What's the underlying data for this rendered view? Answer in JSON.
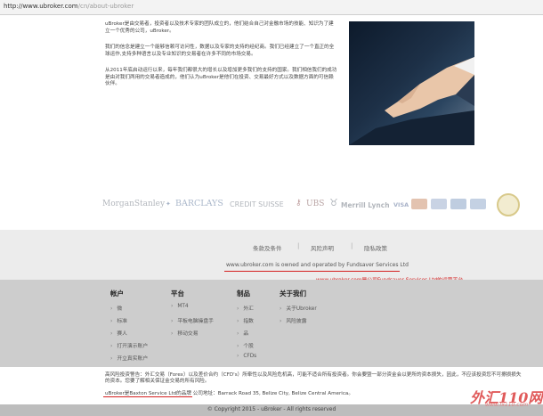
{
  "address_bar": {
    "url_main": "http://www.ubroker.com",
    "url_path": "/cn/about-ubroker"
  },
  "about": {
    "paragraphs": [
      "uBroker是由交易者，投资者以及技术专家的团队成立的，他们结合自己对金融市场的技能、知识为了建立一个优秀的公司，uBroker。",
      "我们的信念是建立一个能够信赖可访问性，数据以及专家的支持的经纪商。我们已经建立了一个直正的全球运作,支持多种语言以及专业知识的交易者在许多不同的市场交易。",
      "从2011年底启动运行以来，每年我们都很大的增长以及增加更多我们的支持的国家。我们相信我们的成功是由对我们两用的交易者造成的，他们认为uBroker是他们在投资、交易最好方式以及数据方面的可信赖伙伴。"
    ]
  },
  "partners": [
    "MorganStanley",
    "BARCLAYS",
    "CREDIT SUISSE",
    "UBS",
    "Merrill Lynch",
    "VISA"
  ],
  "footer_links": [
    "条款及条件",
    "风险声明",
    "隐私政策"
  ],
  "owned_text": "www.ubroker.com is owned and operated by Fundsaver Services Ltd",
  "owned_note": "www.ubroker.com是公司Fundsaver Services Ltd的运营平台",
  "menu": {
    "accounts": {
      "title": "帐户",
      "items": [
        "微",
        "标准",
        "赛人",
        "打开演示账户",
        "开立真实账户"
      ]
    },
    "platform": {
      "title": "平台",
      "items": [
        "MT4",
        "平板电脑操盘手",
        "移动交易"
      ]
    },
    "products": {
      "title": "制品",
      "items": [
        "外汇",
        "指数",
        "品",
        "个股",
        "CFDs"
      ]
    },
    "about": {
      "title": "关于我们",
      "items": [
        "关于Ubroker",
        "风险披露"
      ]
    }
  },
  "disclaimer": "高风险投资警告：外汇交易（Forex）以及差价合约（CFD's）所牵性以及风险危机高，可能不适合所有投资者。你会要暨一部分资金会以更所的资本损失，因此，不应该投资您不可擦损损失的资本。您要了解相关保证金交易的所有风险。",
  "brand": {
    "text": "uBroker是Baxton Service Ltd的品牌",
    "address": "公司地址：Barrack Road 35, Belize City, Belize Central America。"
  },
  "copyright": "© Copyright 2015 - uBroker - All rights reserved",
  "watermark": {
    "main": "外汇110网",
    "sub": "www.fx110.com"
  },
  "colors": {
    "annotation_red": "#d42020",
    "menu_bg": "#cdcdcd",
    "band_bg": "#ececec"
  }
}
